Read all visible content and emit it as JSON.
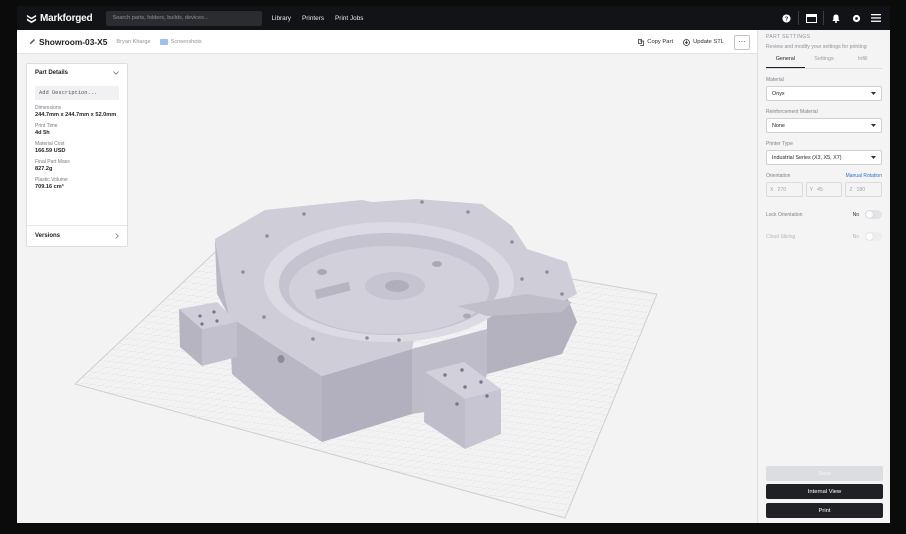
{
  "nav": {
    "logo_text": "Markforged",
    "search_placeholder": "Search parts, folders, builds, devices...",
    "links": [
      "Library",
      "Printers",
      "Print Jobs"
    ],
    "icons": [
      "help-icon",
      "window-icon",
      "bell-icon",
      "settings-icon",
      "menu-icon"
    ]
  },
  "header": {
    "part_name": "Showroom-03-X5",
    "author": "Bryan Kharge",
    "folder": "Screenshots",
    "copy_part": "Copy Part",
    "update_stl": "Update STL",
    "more": "⋯"
  },
  "part_details": {
    "title": "Part Details",
    "description_placeholder": "Add Description...",
    "fields": [
      {
        "label": "Dimensions",
        "value": "244.7mm x 244.7mm x 52.0mm"
      },
      {
        "label": "Print Time",
        "value": "4d 5h"
      },
      {
        "label": "Material Cost",
        "value": "166.59 USD"
      },
      {
        "label": "Final Part Mass",
        "value": "827.2g"
      },
      {
        "label": "Plastic Volume",
        "value": "709.16 cm³"
      }
    ],
    "versions": "Versions"
  },
  "settings": {
    "section_title": "PART SETTINGS",
    "subtitle": "Review and modify your settings for printing",
    "tabs": [
      "General",
      "Settings",
      "Infill"
    ],
    "active_tab": "General",
    "material_label": "Material",
    "material_value": "Onyx",
    "reinforcement_label": "Reinforcement Material",
    "reinforcement_value": "None",
    "printer_type_label": "Printer Type",
    "printer_type_value": "Industrial Series (X3, X5, X7)",
    "orientation_label": "Orientation",
    "manual_rotation": "Manual Rotation",
    "orientation": {
      "x_label": "X",
      "x": "270",
      "y_label": "Y",
      "y": "45",
      "z_label": "Z",
      "z": "180"
    },
    "lock_orientation_label": "Lock Orientation",
    "lock_orientation_state": "No",
    "cloud_slicing_label": "Cloud Slicing",
    "cloud_slicing_state": "No",
    "save": "Save",
    "internal_view": "Internal View",
    "print": "Print"
  },
  "colors": {
    "nav_bg": "#121316",
    "part_fill": "#c9c7d3",
    "dark_button": "#1f2127",
    "link": "#2f74c7"
  }
}
